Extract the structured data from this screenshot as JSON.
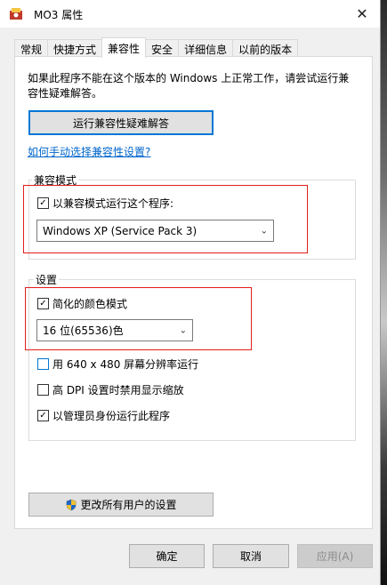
{
  "window": {
    "title": "MO3 属性",
    "close_glyph": "✕"
  },
  "tabs": [
    {
      "label": "常规",
      "active": false
    },
    {
      "label": "快捷方式",
      "active": false
    },
    {
      "label": "兼容性",
      "active": true
    },
    {
      "label": "安全",
      "active": false
    },
    {
      "label": "详细信息",
      "active": false
    },
    {
      "label": "以前的版本",
      "active": false
    }
  ],
  "intro_text": "如果此程序不能在这个版本的 Windows 上正常工作，请尝试运行兼容性疑难解答。",
  "troubleshooter_button": "运行兼容性疑难解答",
  "manual_link": "如何手动选择兼容性设置?",
  "compat_mode": {
    "group_label": "兼容模式",
    "checkbox_label": "以兼容模式运行这个程序:",
    "checked": true,
    "selected_os": "Windows XP (Service Pack 3)"
  },
  "settings": {
    "group_label": "设置",
    "reduced_color": {
      "label": "简化的颜色模式",
      "checked": true
    },
    "color_depth": "16 位(65536)色",
    "resolution_640": {
      "label": "用 640 x 480 屏幕分辨率运行",
      "checked": false
    },
    "high_dpi": {
      "label": "高 DPI 设置时禁用显示缩放",
      "checked": false
    },
    "run_as_admin": {
      "label": "以管理员身份运行此程序",
      "checked": true
    }
  },
  "all_users_button": "更改所有用户的设置",
  "footer": {
    "ok": "确定",
    "cancel": "取消",
    "apply": "应用(A)"
  },
  "icons": {
    "close": "close-icon",
    "app": "app-icon",
    "shield": "uac-shield-icon",
    "dropdown": "chevron-down-icon",
    "check": "checkmark-icon"
  },
  "colors": {
    "focus_blue": "#0078d7",
    "link_blue": "#0066cc",
    "highlight_red": "#e21d1d",
    "disabled_text": "#8c8c8c"
  }
}
